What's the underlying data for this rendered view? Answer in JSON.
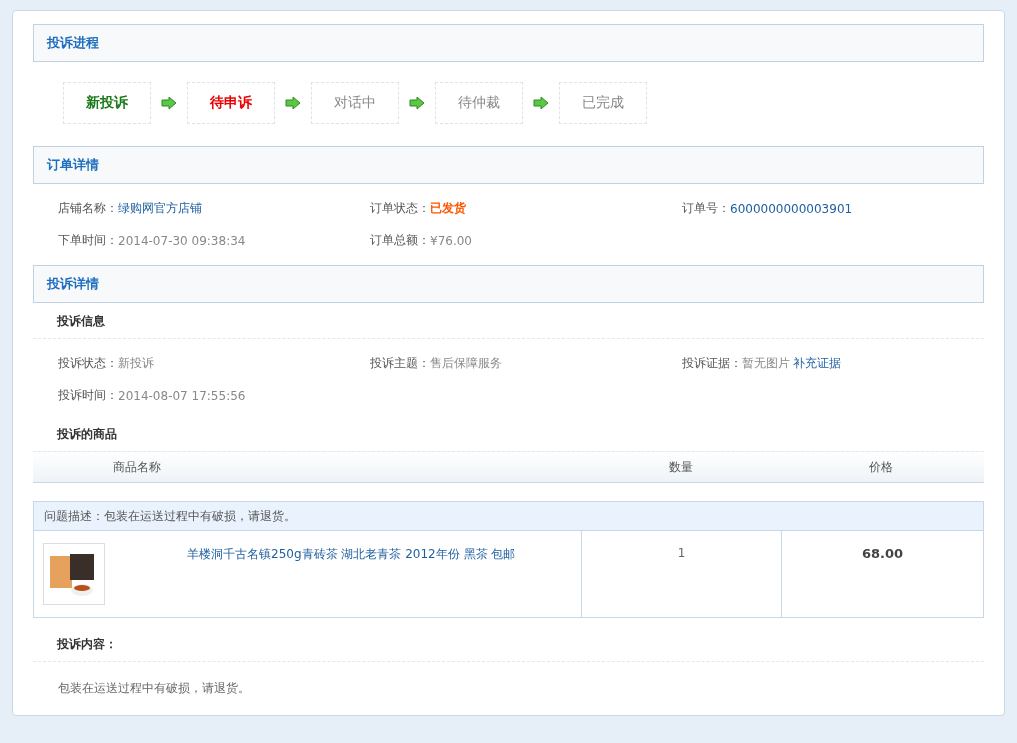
{
  "progress": {
    "title": "投诉进程",
    "steps": [
      {
        "label": "新投诉",
        "completed": true,
        "current": false
      },
      {
        "label": "待申诉",
        "completed": false,
        "current": true
      },
      {
        "label": "对话中",
        "completed": false,
        "current": false
      },
      {
        "label": "待仲裁",
        "completed": false,
        "current": false
      },
      {
        "label": "已完成",
        "completed": false,
        "current": false
      }
    ]
  },
  "order": {
    "title": "订单详情",
    "fields": [
      {
        "label": "店铺名称：",
        "value": "绿购网官方店铺",
        "kind": "link"
      },
      {
        "label": "订单状态：",
        "value": "已发货",
        "kind": "alert"
      },
      {
        "label": "订单号：",
        "value": "6000000000003901",
        "kind": "link"
      },
      {
        "label": "下单时间：",
        "value": "2014-07-30 09:38:34",
        "kind": "plain"
      },
      {
        "label": "订单总额：",
        "value": "¥76.00",
        "kind": "plain"
      }
    ]
  },
  "complaint": {
    "title": "投诉详情",
    "info_heading": "投诉信息",
    "fields": [
      {
        "label": "投诉状态：",
        "value": "新投诉"
      },
      {
        "label": "投诉主题：",
        "value": "售后保障服务"
      },
      {
        "label": "投诉证据：",
        "value": "暂无图片",
        "link": "补充证据"
      },
      {
        "label": "投诉时间：",
        "value": "2014-08-07 17:55:56"
      }
    ],
    "goods_heading": "投诉的商品",
    "columns": [
      "商品名称",
      "数量",
      "价格"
    ],
    "description": "问题描述：包装在运送过程中有破损，请退货。",
    "items": [
      {
        "name": "羊楼洞千古名镇250g青砖茶 湖北老青茶 2012年份 黑茶 包邮",
        "quantity": "1",
        "price": "68.00"
      }
    ],
    "content_heading": "投诉内容：",
    "content": "包装在运送过程中有破损，请退货。"
  }
}
